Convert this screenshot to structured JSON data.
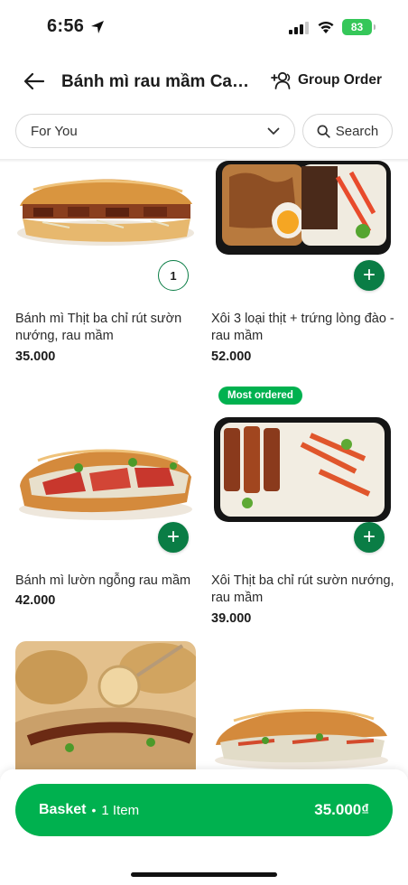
{
  "status": {
    "time": "6:56",
    "battery": "83"
  },
  "header": {
    "title": "Bánh mì rau mầm Car...",
    "group_order": "Group Order"
  },
  "filters": {
    "category": "For You",
    "search": "Search"
  },
  "items": [
    {
      "name": "Bánh mì Thịt ba chỉ rút sườn nướng, rau mầm",
      "price": "35.000",
      "qty": "1"
    },
    {
      "name": "Xôi 3 loại thịt + trứng lòng đào - rau mầm",
      "price": "52.000"
    },
    {
      "name": "Bánh mì lườn ngỗng rau mầm",
      "price": "42.000"
    },
    {
      "name": "Xôi Thịt ba chỉ rút sườn nướng, rau mầm",
      "price": "39.000",
      "badge": "Most ordered"
    }
  ],
  "basket": {
    "label": "Basket",
    "count": "1 Item",
    "total": "35.000₫"
  },
  "colors": {
    "brand": "#00b14f",
    "button_dark": "#0a7d45"
  }
}
